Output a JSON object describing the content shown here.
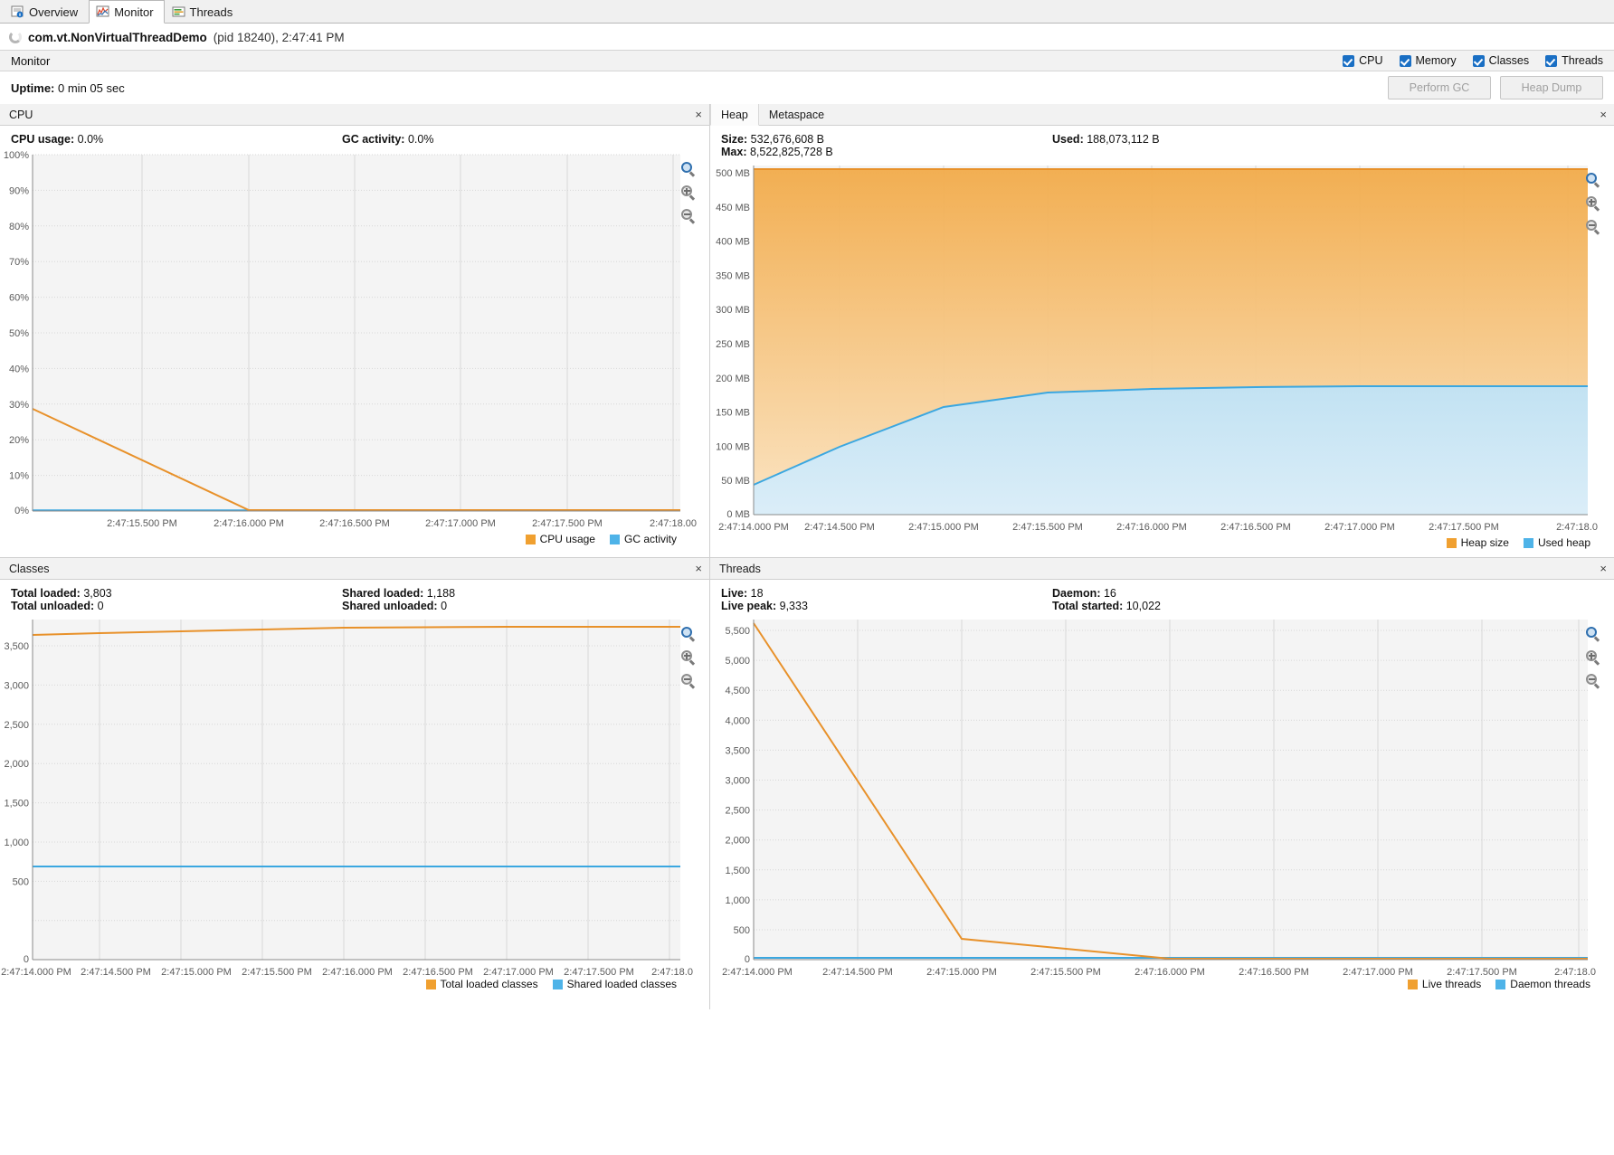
{
  "tabs": [
    {
      "label": "Overview",
      "icon": "overview-icon",
      "active": false
    },
    {
      "label": "Monitor",
      "icon": "monitor-icon",
      "active": true
    },
    {
      "label": "Threads",
      "icon": "threads-icon",
      "active": false
    }
  ],
  "app": {
    "name": "com.vt.NonVirtualThreadDemo",
    "meta": "(pid 18240), 2:47:41 PM",
    "spinner_icon": "busy-spinner-icon"
  },
  "monitor_bar": {
    "label": "Monitor",
    "checkboxes": [
      {
        "label": "CPU",
        "checked": true
      },
      {
        "label": "Memory",
        "checked": true
      },
      {
        "label": "Classes",
        "checked": true
      },
      {
        "label": "Threads",
        "checked": true
      }
    ],
    "checkbox_color": "#1a6fc4"
  },
  "uptime": {
    "label": "Uptime:",
    "value": "0 min 05 sec"
  },
  "actions": [
    {
      "label": "Perform GC",
      "enabled": false
    },
    {
      "label": "Heap Dump",
      "enabled": false
    }
  ],
  "colors": {
    "orange": "#f0a030",
    "orange_line": "#e8912a",
    "blue": "#4eb3e8",
    "blue_line": "#3ba7e0",
    "plot_bg": "#f4f4f4",
    "grid": "#d7d7d7"
  },
  "panels": {
    "cpu": {
      "title": "CPU",
      "close_label": "×",
      "stats": [
        {
          "label": "CPU usage:",
          "value": "0.0%"
        },
        {
          "label": "GC activity:",
          "value": "0.0%"
        }
      ],
      "legend": [
        {
          "label": "CPU usage",
          "color": "#f0a030"
        },
        {
          "label": "GC activity",
          "color": "#4eb3e8"
        }
      ]
    },
    "heap": {
      "tabs": [
        {
          "label": "Heap",
          "selected": true
        },
        {
          "label": "Metaspace",
          "selected": false
        }
      ],
      "close_label": "×",
      "stats": [
        {
          "label": "Size:",
          "value": "532,676,608 B"
        },
        {
          "label": "Used:",
          "value": "188,073,112 B"
        },
        {
          "label": "Max:",
          "value": "8,522,825,728 B"
        }
      ],
      "legend": [
        {
          "label": "Heap size",
          "color": "#f0a030"
        },
        {
          "label": "Used heap",
          "color": "#4eb3e8"
        }
      ]
    },
    "classes": {
      "title": "Classes",
      "close_label": "×",
      "stats": [
        {
          "label": "Total loaded:",
          "value": "3,803"
        },
        {
          "label": "Shared loaded:",
          "value": "1,188"
        },
        {
          "label": "Total unloaded:",
          "value": "0"
        },
        {
          "label": "Shared unloaded:",
          "value": "0"
        }
      ],
      "legend": [
        {
          "label": "Total loaded classes",
          "color": "#f0a030"
        },
        {
          "label": "Shared loaded classes",
          "color": "#4eb3e8"
        }
      ]
    },
    "threads": {
      "title": "Threads",
      "close_label": "×",
      "stats": [
        {
          "label": "Live:",
          "value": "18"
        },
        {
          "label": "Daemon:",
          "value": "16"
        },
        {
          "label": "Live peak:",
          "value": "9,333"
        },
        {
          "label": "Total started:",
          "value": "10,022"
        }
      ],
      "legend": [
        {
          "label": "Live threads",
          "color": "#f0a030"
        },
        {
          "label": "Daemon threads",
          "color": "#4eb3e8"
        }
      ]
    }
  },
  "zoom_controls": [
    {
      "name": "zoom-fit-icon",
      "selected": true
    },
    {
      "name": "zoom-in-icon",
      "selected": false
    },
    {
      "name": "zoom-out-icon",
      "selected": false
    }
  ],
  "chart_data": [
    {
      "type": "line",
      "id": "cpu",
      "title": "CPU",
      "xlabel": "",
      "ylabel": "",
      "ylim": [
        0,
        100
      ],
      "yticks": [
        "0%",
        "10%",
        "20%",
        "30%",
        "40%",
        "50%",
        "60%",
        "70%",
        "80%",
        "90%",
        "100%"
      ],
      "xticks": [
        "2:47:15.500 PM",
        "2:47:16.000 PM",
        "2:47:16.500 PM",
        "2:47:17.000 PM",
        "2:47:17.500 PM",
        "2:47:18.00"
      ],
      "x": [
        0,
        1,
        2,
        3,
        4,
        5,
        6,
        7,
        8
      ],
      "series": [
        {
          "name": "CPU usage",
          "color": "#f0a030",
          "values": [
            28.5,
            21.0,
            13.5,
            0,
            0,
            0,
            0,
            0,
            0
          ]
        },
        {
          "name": "GC activity",
          "color": "#4eb3e8",
          "values": [
            0,
            0,
            0,
            0,
            0,
            0,
            0,
            0,
            0
          ]
        }
      ],
      "grid": true,
      "legend_position": "bottom-right"
    },
    {
      "type": "area",
      "id": "heap",
      "title": "Heap",
      "xlabel": "",
      "ylabel": "",
      "ylim": [
        0,
        532676608
      ],
      "yticks": [
        "0 MB",
        "50 MB",
        "100 MB",
        "150 MB",
        "200 MB",
        "250 MB",
        "300 MB",
        "350 MB",
        "400 MB",
        "450 MB",
        "500 MB"
      ],
      "xticks": [
        "2:47:14.000 PM",
        "2:47:14.500 PM",
        "2:47:15.000 PM",
        "2:47:15.500 PM",
        "2:47:16.000 PM",
        "2:47:16.500 PM",
        "2:47:17.000 PM",
        "2:47:17.500 PM",
        "2:47:18.0"
      ],
      "x": [
        0,
        1,
        2,
        3,
        4,
        5,
        6,
        7,
        8
      ],
      "series": [
        {
          "name": "Heap size",
          "color": "#f0a030",
          "unit": "MB",
          "values": [
            508,
            508,
            508,
            508,
            508,
            508,
            508,
            508,
            508
          ]
        },
        {
          "name": "Used heap",
          "color": "#4eb3e8",
          "unit": "MB",
          "values": [
            44,
            105,
            163,
            170,
            175,
            177,
            179,
            179,
            179
          ]
        }
      ],
      "grid": true,
      "legend_position": "bottom-right"
    },
    {
      "type": "line",
      "id": "classes",
      "title": "Classes",
      "xlabel": "",
      "ylabel": "",
      "ylim": [
        0,
        4000
      ],
      "yticks": [
        "0",
        "500",
        "1,000",
        "1,500",
        "2,000",
        "2,500",
        "3,000",
        "3,500"
      ],
      "xticks": [
        "2:47:14.000 PM",
        "2:47:14.500 PM",
        "2:47:15.000 PM",
        "2:47:15.500 PM",
        "2:47:16.000 PM",
        "2:47:16.500 PM",
        "2:47:17.000 PM",
        "2:47:17.500 PM",
        "2:47:18.0"
      ],
      "x": [
        0,
        1,
        2,
        3,
        4,
        5,
        6,
        7,
        8
      ],
      "series": [
        {
          "name": "Total loaded classes",
          "color": "#f0a030",
          "values": [
            3760,
            3770,
            3780,
            3790,
            3798,
            3801,
            3803,
            3803,
            3803
          ]
        },
        {
          "name": "Shared loaded classes",
          "color": "#4eb3e8",
          "values": [
            1188,
            1188,
            1188,
            1188,
            1188,
            1188,
            1188,
            1188,
            1188
          ]
        }
      ],
      "grid": true,
      "legend_position": "bottom-right"
    },
    {
      "type": "line",
      "id": "threads",
      "title": "Threads",
      "xlabel": "",
      "ylabel": "",
      "ylim": [
        0,
        6000
      ],
      "yticks": [
        "0",
        "500",
        "1,000",
        "1,500",
        "2,000",
        "2,500",
        "3,000",
        "3,500",
        "4,000",
        "4,500",
        "5,000",
        "5,500"
      ],
      "xticks": [
        "2:47:14.000 PM",
        "2:47:14.500 PM",
        "2:47:15.000 PM",
        "2:47:15.500 PM",
        "2:47:16.000 PM",
        "2:47:16.500 PM",
        "2:47:17.000 PM",
        "2:47:17.500 PM",
        "2:47:18.0"
      ],
      "x": [
        0,
        1,
        2,
        3,
        4,
        5,
        6,
        7,
        8
      ],
      "series": [
        {
          "name": "Live threads",
          "color": "#f0a030",
          "values": [
            5780,
            3050,
            340,
            18,
            18,
            18,
            18,
            18,
            18
          ]
        },
        {
          "name": "Daemon threads",
          "color": "#4eb3e8",
          "values": [
            16,
            16,
            16,
            16,
            16,
            16,
            16,
            16,
            16
          ]
        }
      ],
      "grid": true,
      "legend_position": "bottom-right"
    }
  ]
}
